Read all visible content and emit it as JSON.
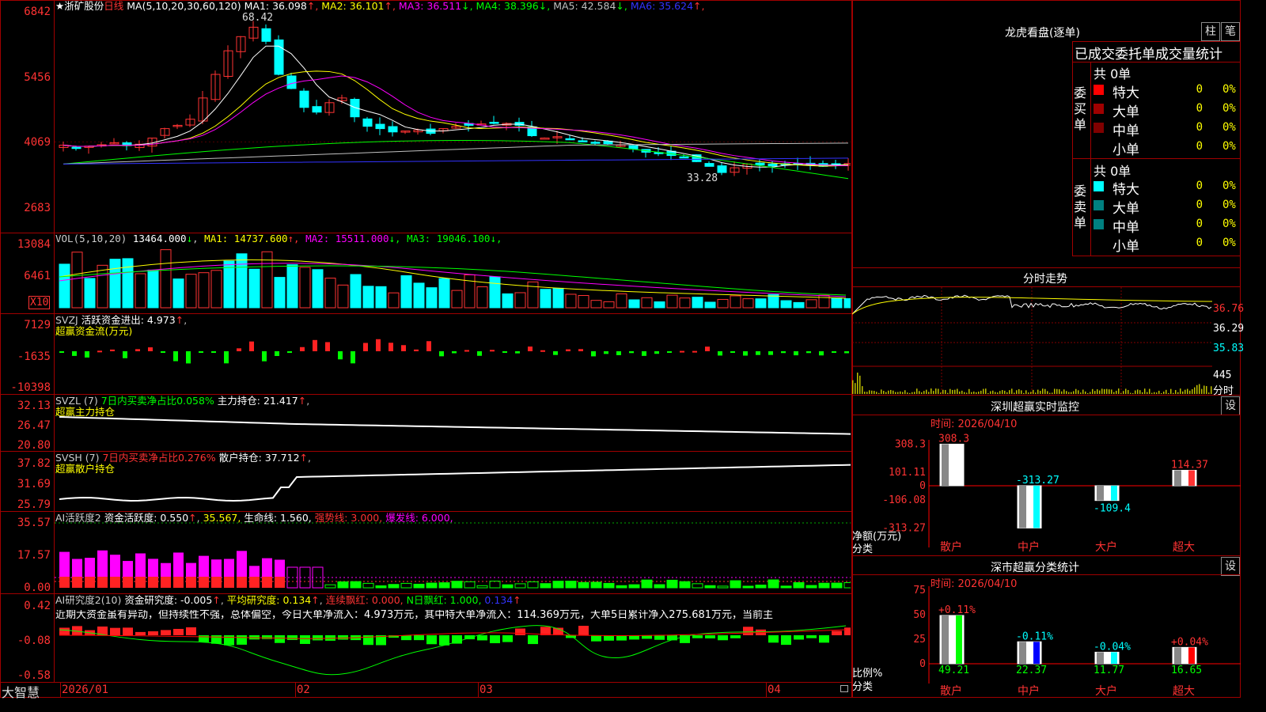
{
  "stock": {
    "star": "★",
    "name": "浙矿股份",
    "period": "日线"
  },
  "brand": "大智慧",
  "main_panel": {
    "ma_label": "MA(5,10,20,30,60,120)",
    "ma": [
      {
        "label": "MA1: 36.098",
        "arrow": "↑",
        "color": "#ffffff"
      },
      {
        "label": "MA2: 36.101",
        "arrow": "↑",
        "color": "#ffff00"
      },
      {
        "label": "MA3: 36.511",
        "arrow": "↓",
        "color": "#ff00ff"
      },
      {
        "label": "MA4: 38.396",
        "arrow": "↓",
        "color": "#00ff00"
      },
      {
        "label": "MA5: 42.584",
        "arrow": "↓",
        "color": "#c0c0c0"
      },
      {
        "label": "MA6: 35.624",
        "arrow": "↑",
        "color": "#3333ff"
      }
    ],
    "y_ticks": [
      "6842",
      "5456",
      "4069",
      "2683"
    ],
    "high_label": "68.42",
    "low_label": "33.28"
  },
  "vol_panel": {
    "title": "VOL(5,10,20)",
    "value": "13464.000",
    "value_arrow": "↓",
    "ma": [
      {
        "label": "MA1: 14737.600",
        "arrow": "↑",
        "color": "#ffff00"
      },
      {
        "label": "MA2: 15511.000",
        "arrow": "↓",
        "color": "#ff00ff"
      },
      {
        "label": "MA3: 19046.100",
        "arrow": "↓",
        "color": "#00ff00"
      }
    ],
    "y_ticks": [
      "13084",
      "6461"
    ],
    "unit": "X10"
  },
  "svzj_panel": {
    "title": "SVZJ",
    "label": "活跃资金进出: 4.973",
    "arrow": "↑",
    "subtitle": "超赢资金流(万元)",
    "y_ticks": [
      "7129",
      "-1635",
      "-10398"
    ]
  },
  "svzl_panel": {
    "title": "SVZL (7)",
    "ratio": "7日内买卖净占比0.058%",
    "hold": "主力持仓: 21.417",
    "arrow": "↑",
    "subtitle": "超赢主力持仓",
    "y_ticks": [
      "32.13",
      "26.47",
      "20.80"
    ]
  },
  "svsh_panel": {
    "title": "SVSH (7)",
    "ratio": "7日内买卖净占比0.276%",
    "hold": "散户持仓: 37.712",
    "arrow": "↑",
    "subtitle": "超赢散户持仓",
    "y_ticks": [
      "37.82",
      "31.69",
      "25.79"
    ]
  },
  "ai_panel": {
    "title": "AI活跃度2",
    "label1": "资金活跃度: 0.550",
    "label2": "35.567,",
    "label3": "生命线: 1.560,",
    "label4": "强势线: 3.000,",
    "label5": "爆发线: 6.000,",
    "y_ticks": [
      "35.57",
      "17.57",
      "0.00"
    ]
  },
  "research_panel": {
    "title": "AI研究度2(10)",
    "label1": "资金研究度: -0.005",
    "label2": "平均研究度: 0.134",
    "label3": "连续飘红: 0.000,",
    "label4": "N日飘红: 1.000,",
    "label5": "0.134",
    "comment": "近期大资金虽有异动，但持续性不强，总体偏空，今日大单净流入：4.973万元，其中特大单净流入：114.369万元，大单5日累计净入275.681万元，当前主",
    "y_ticks": [
      "0.42",
      "-0.08",
      "-0.58"
    ]
  },
  "x_axis": [
    "2026/01",
    "02",
    "03",
    "04"
  ],
  "right_panel": {
    "dragon_title": "龙虎看盘(逐单)",
    "btn_zhu": "柱",
    "btn_bi": "笔",
    "table_title": "已成交委托单成交量统计",
    "buy_label": "委买单",
    "sell_label": "委卖单",
    "buy_total": "共 0单",
    "sell_total": "共 0单",
    "buy_rows": [
      {
        "name": "特大",
        "count": "0",
        "pct": "0%",
        "color": "#ff0000"
      },
      {
        "name": "大单",
        "count": "0",
        "pct": "0%",
        "color": "#a00000"
      },
      {
        "name": "中单",
        "count": "0",
        "pct": "0%",
        "color": "#800000"
      },
      {
        "name": "小单",
        "count": "0",
        "pct": "0%",
        "color": ""
      }
    ],
    "sell_rows": [
      {
        "name": "特大",
        "count": "0",
        "pct": "0%",
        "color": "#00ffff"
      },
      {
        "name": "大单",
        "count": "0",
        "pct": "0%",
        "color": "#008080"
      },
      {
        "name": "中单",
        "count": "0",
        "pct": "0%",
        "color": "#008080"
      },
      {
        "name": "小单",
        "count": "0",
        "pct": "0%",
        "color": ""
      }
    ],
    "intraday_title": "分时走势",
    "intraday_prices": [
      "36.76",
      "36.29",
      "35.83"
    ],
    "intraday_vol": "445",
    "intraday_vol_label": "分时",
    "monitor_title": "深圳超赢实时监控",
    "monitor_btn": "设",
    "monitor_time": "时间: 2026/04/10",
    "monitor_y": [
      "308.3",
      "101.11",
      "0",
      "-106.08",
      "-313.27"
    ],
    "monitor_ylabel": "净额(万元)",
    "monitor_xlabel": "分类",
    "stats_title": "深市超赢分类统计",
    "stats_btn": "设",
    "stats_time": "时间: 2026/04/10",
    "stats_y": [
      "75",
      "50",
      "25",
      "0"
    ],
    "stats_ylabel": "比例%",
    "stats_xlabel": "分类"
  },
  "chart_data": [
    {
      "type": "bar",
      "title": "深圳超赢实时监控",
      "categories": [
        "散户",
        "中户",
        "大户",
        "超大"
      ],
      "values": [
        308.3,
        -313.27,
        -109.4,
        114.37
      ],
      "ylabel": "净额(万元)",
      "xlabel": "分类",
      "ylim": [
        -313.27,
        308.3
      ],
      "colors": [
        "#ffffff",
        "#00ffff",
        "#00ffff",
        "#ff3333"
      ]
    },
    {
      "type": "bar",
      "title": "深市超赢分类统计",
      "categories": [
        "散户",
        "中户",
        "大户",
        "超大"
      ],
      "values": [
        49.21,
        22.37,
        11.77,
        16.65
      ],
      "changes": [
        "+0.11%",
        "-0.11%",
        "-0.04%",
        "+0.04%"
      ],
      "ylabel": "比例%",
      "xlabel": "分类",
      "ylim": [
        0,
        75
      ],
      "colors": [
        "#00ff00",
        "#0000ff",
        "#00ffff",
        "#ff0000"
      ]
    }
  ]
}
